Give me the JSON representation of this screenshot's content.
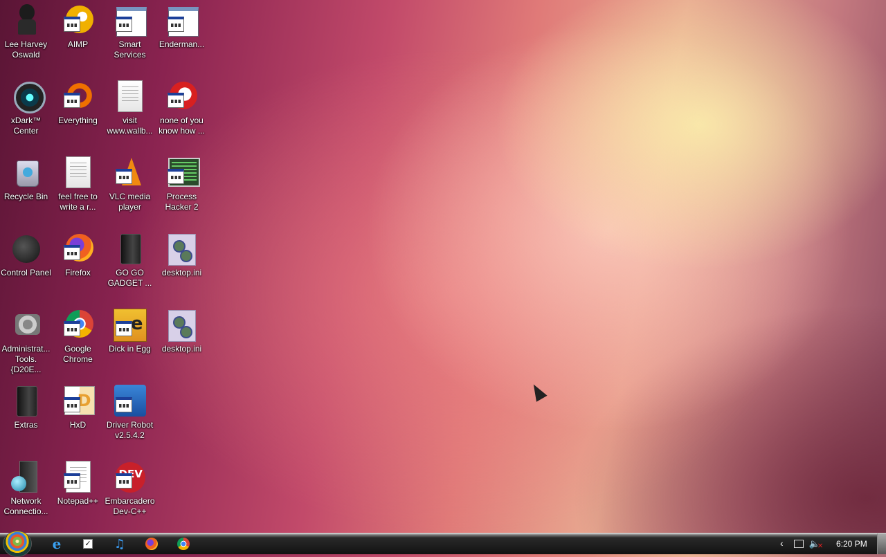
{
  "desktop": {
    "icons": [
      {
        "label": "Lee Harvey Oswald",
        "icon": "character-icon"
      },
      {
        "label": "AIMP",
        "icon": "aimp-icon"
      },
      {
        "label": "Smart Services",
        "icon": "services-gear-icon"
      },
      {
        "label": "Enderman...",
        "icon": "window-icon"
      },
      {
        "label": "xDark™ Center",
        "icon": "xdark-icon"
      },
      {
        "label": "Everything",
        "icon": "everything-icon"
      },
      {
        "label": "visit www.wallb...",
        "icon": "text-file-icon"
      },
      {
        "label": "none of you know how ...",
        "icon": "red-circle-icon"
      },
      {
        "label": "Recycle Bin",
        "icon": "recycle-bin-icon"
      },
      {
        "label": "feel free to write a r...",
        "icon": "text-file-icon"
      },
      {
        "label": "VLC media player",
        "icon": "vlc-icon"
      },
      {
        "label": "Process Hacker 2",
        "icon": "process-hacker-icon"
      },
      {
        "label": "Control Panel",
        "icon": "control-panel-icon"
      },
      {
        "label": "Firefox",
        "icon": "firefox-icon"
      },
      {
        "label": "GO GO GADGET ...",
        "icon": "folder-icon"
      },
      {
        "label": "desktop.ini",
        "icon": "ini-file-icon"
      },
      {
        "label": "Administrat... Tools.{D20E...",
        "icon": "admin-tools-icon"
      },
      {
        "label": "Google Chrome",
        "icon": "chrome-icon"
      },
      {
        "label": "Dick in Egg",
        "icon": "egg-app-icon"
      },
      {
        "label": "desktop.ini",
        "icon": "ini-file-icon"
      },
      {
        "label": "Extras",
        "icon": "folder-icon"
      },
      {
        "label": "HxD",
        "icon": "hxd-icon"
      },
      {
        "label": "Driver Robot v2.5.4.2",
        "icon": "driver-robot-icon"
      },
      {
        "label": "Network Connectio...",
        "icon": "network-icon"
      },
      {
        "label": "Notepad++",
        "icon": "notepad-plus-plus-icon"
      },
      {
        "label": "Embarcadero Dev-C++",
        "icon": "devcpp-icon"
      }
    ]
  },
  "taskbar": {
    "pinned": [
      {
        "name": "internet-explorer-icon"
      },
      {
        "name": "task-checkbox-icon"
      },
      {
        "name": "music-note-icon"
      },
      {
        "name": "firefox-icon"
      },
      {
        "name": "chrome-icon"
      }
    ],
    "tray": {
      "chevron": "‹",
      "clock": "6:20 PM"
    }
  },
  "colors": {
    "taskbar": "#111111",
    "label_text": "#ffffff"
  }
}
